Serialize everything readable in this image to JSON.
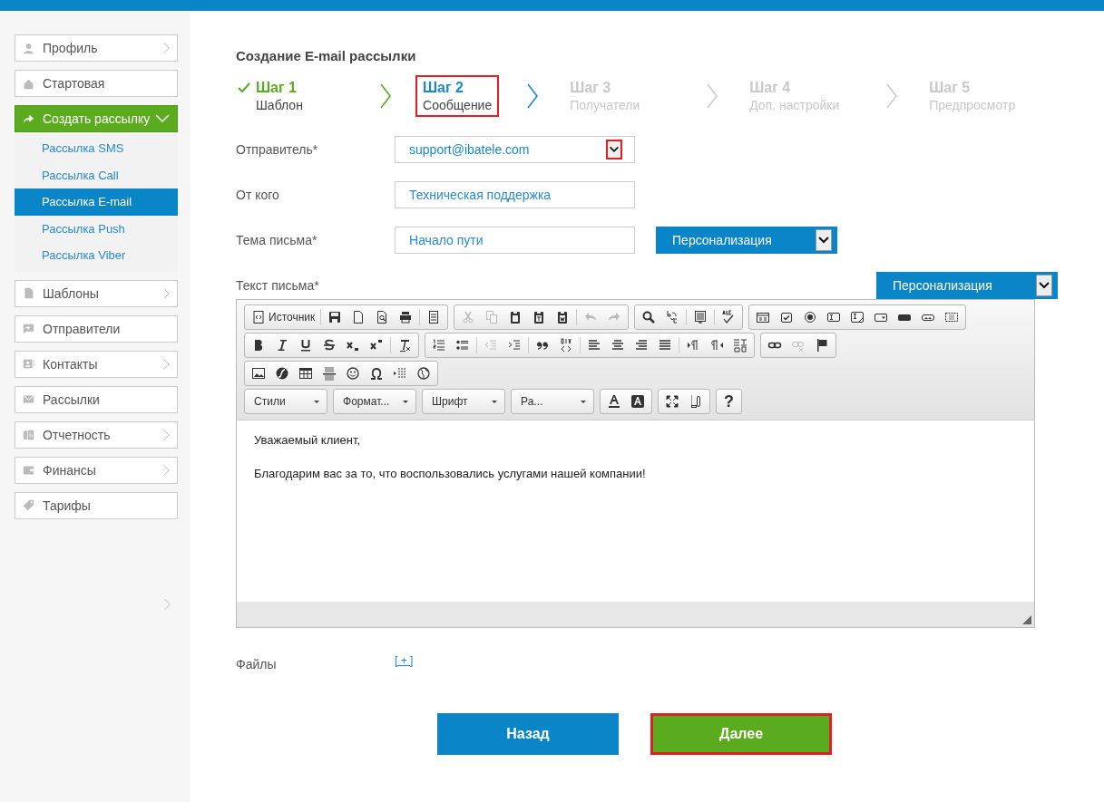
{
  "sidebar": {
    "items": [
      {
        "label": "Профиль",
        "kind": "user",
        "chevron": true,
        "selected": false
      },
      {
        "label": "Стартовая",
        "kind": "home",
        "chevron": false,
        "selected": false
      },
      {
        "label": "Создать рассылку",
        "kind": "share",
        "chevron": false,
        "selected": true,
        "expanded": true,
        "children": [
          {
            "label": "Рассылка SMS",
            "selected": false
          },
          {
            "label": "Рассылка Call",
            "selected": false
          },
          {
            "label": "Рассылка E-mail",
            "selected": true
          },
          {
            "label": "Рассылка Push",
            "selected": false
          },
          {
            "label": "Рассылка Viber",
            "selected": false
          }
        ]
      },
      {
        "label": "Шаблоны",
        "kind": "doc",
        "chevron": true,
        "selected": false
      },
      {
        "label": "Отправители",
        "kind": "sender",
        "chevron": false,
        "selected": false
      },
      {
        "label": "Контакты",
        "kind": "contacts",
        "chevron": true,
        "selected": false
      },
      {
        "label": "Рассылки",
        "kind": "mail",
        "chevron": false,
        "selected": false
      },
      {
        "label": "Отчетность",
        "kind": "report",
        "chevron": true,
        "selected": false
      },
      {
        "label": "Финансы",
        "kind": "wallet",
        "chevron": true,
        "selected": false
      },
      {
        "label": "Тарифы",
        "kind": "tag",
        "chevron": false,
        "selected": false
      }
    ]
  },
  "page_title": "Создание E-mail рассылки",
  "steps": [
    {
      "title": "Шаг 1",
      "subtitle": "Шаблон",
      "kind": "done",
      "highlighted": false
    },
    {
      "title": "Шаг 2",
      "subtitle": "Сообщение",
      "kind": "current",
      "highlighted": true
    },
    {
      "title": "Шаг 3",
      "subtitle": "Получатели",
      "kind": "upcoming",
      "highlighted": false
    },
    {
      "title": "Шаг 4",
      "subtitle": "Доп. настройки",
      "kind": "upcoming",
      "highlighted": false
    },
    {
      "title": "Шаг 5",
      "subtitle": "Предпросмотр",
      "kind": "upcoming",
      "highlighted": false
    }
  ],
  "form": {
    "sender": {
      "label": "Отправитель*",
      "value": "support@ibatele.com",
      "arrow_highlighted": true
    },
    "from": {
      "label": "От кого",
      "value": "Техническая поддержка"
    },
    "subject": {
      "label": "Тема письма*",
      "value": "Начало пути",
      "personalization": "Персонализация"
    },
    "body": {
      "label": "Текст письма*",
      "personalization": "Персонализация"
    }
  },
  "editor": {
    "toolbar": [
      [
        [
          {
            "kind": "source",
            "label": "Источник",
            "disabled": false
          },
          {
            "kind": "sep"
          },
          {
            "kind": "save",
            "disabled": false
          },
          {
            "kind": "newpage",
            "disabled": false
          },
          {
            "kind": "preview",
            "disabled": false
          },
          {
            "kind": "print",
            "disabled": false
          },
          {
            "kind": "sep"
          },
          {
            "kind": "templates",
            "disabled": false
          }
        ],
        [
          {
            "kind": "cut",
            "disabled": true
          },
          {
            "kind": "copy",
            "disabled": true
          },
          {
            "kind": "paste",
            "disabled": false
          },
          {
            "kind": "pastetext",
            "disabled": false
          },
          {
            "kind": "pasteword",
            "disabled": false
          },
          {
            "kind": "sep"
          },
          {
            "kind": "undo",
            "disabled": true
          },
          {
            "kind": "redo",
            "disabled": true
          }
        ],
        [
          {
            "kind": "find",
            "disabled": false
          },
          {
            "kind": "replace",
            "disabled": false
          },
          {
            "kind": "sep"
          },
          {
            "kind": "selectall",
            "disabled": false
          },
          {
            "kind": "sep"
          },
          {
            "kind": "spellcheck",
            "disabled": false
          }
        ],
        [
          {
            "kind": "form",
            "disabled": false
          },
          {
            "kind": "checkbox",
            "disabled": false
          },
          {
            "kind": "radio",
            "disabled": false
          },
          {
            "kind": "textfield",
            "disabled": false
          },
          {
            "kind": "textarea",
            "disabled": false
          },
          {
            "kind": "select",
            "disabled": false
          },
          {
            "kind": "button",
            "disabled": false
          },
          {
            "kind": "imagebutton",
            "disabled": false
          },
          {
            "kind": "hiddenfield",
            "disabled": false
          }
        ]
      ],
      [
        [
          {
            "kind": "bold",
            "disabled": false
          },
          {
            "kind": "italic",
            "disabled": false
          },
          {
            "kind": "underline",
            "disabled": false
          },
          {
            "kind": "strike",
            "disabled": false
          },
          {
            "kind": "subscript",
            "disabled": false
          },
          {
            "kind": "superscript",
            "disabled": false
          },
          {
            "kind": "sep"
          },
          {
            "kind": "removeformat",
            "disabled": false
          }
        ],
        [
          {
            "kind": "numlist",
            "disabled": false
          },
          {
            "kind": "bulllist",
            "disabled": false
          },
          {
            "kind": "sep"
          },
          {
            "kind": "outdent",
            "disabled": true
          },
          {
            "kind": "indent",
            "disabled": false
          },
          {
            "kind": "sep"
          },
          {
            "kind": "blockquote",
            "disabled": false
          },
          {
            "kind": "creatediv",
            "disabled": false
          },
          {
            "kind": "sep"
          },
          {
            "kind": "alignleft",
            "disabled": false
          },
          {
            "kind": "aligncenter",
            "disabled": false
          },
          {
            "kind": "alignright",
            "disabled": false
          },
          {
            "kind": "justify",
            "disabled": false
          },
          {
            "kind": "sep"
          },
          {
            "kind": "ltr",
            "disabled": false
          },
          {
            "kind": "rtl",
            "disabled": false
          },
          {
            "kind": "language",
            "disabled": false
          }
        ],
        [
          {
            "kind": "link",
            "disabled": false
          },
          {
            "kind": "unlink",
            "disabled": true
          },
          {
            "kind": "anchor",
            "disabled": false
          }
        ]
      ],
      [
        [
          {
            "kind": "image",
            "disabled": false
          },
          {
            "kind": "flash",
            "disabled": false
          },
          {
            "kind": "table",
            "disabled": false
          },
          {
            "kind": "hr",
            "disabled": false
          },
          {
            "kind": "smiley",
            "disabled": false
          },
          {
            "kind": "specialchar",
            "disabled": false
          },
          {
            "kind": "pagebreak",
            "disabled": false
          },
          {
            "kind": "iframe",
            "disabled": false
          }
        ]
      ],
      [
        [
          {
            "kind": "combo",
            "label": "Стили",
            "disabled": false
          }
        ],
        [
          {
            "kind": "combo",
            "label": "Формат...",
            "disabled": false
          }
        ],
        [
          {
            "kind": "combo",
            "label": "Шрифт",
            "disabled": false
          }
        ],
        [
          {
            "kind": "combo",
            "label": "Ра...",
            "disabled": false
          }
        ],
        [
          {
            "kind": "textcolor",
            "disabled": false
          },
          {
            "kind": "bgcolor",
            "disabled": false
          }
        ],
        [
          {
            "kind": "maximize",
            "disabled": false
          },
          {
            "kind": "showblocks",
            "disabled": false
          }
        ],
        [
          {
            "kind": "about",
            "label": "?",
            "disabled": false
          }
        ]
      ]
    ],
    "content": [
      "Уважаемый клиент,",
      "Благодарим вас за то, что воспользовались услугами нашей компании!"
    ]
  },
  "files": {
    "label": "Файлы",
    "add": "[ + ]"
  },
  "buttons": [
    {
      "label": "Назад",
      "kind": "back",
      "highlighted": false
    },
    {
      "label": "Далее",
      "kind": "next",
      "highlighted": true
    }
  ]
}
